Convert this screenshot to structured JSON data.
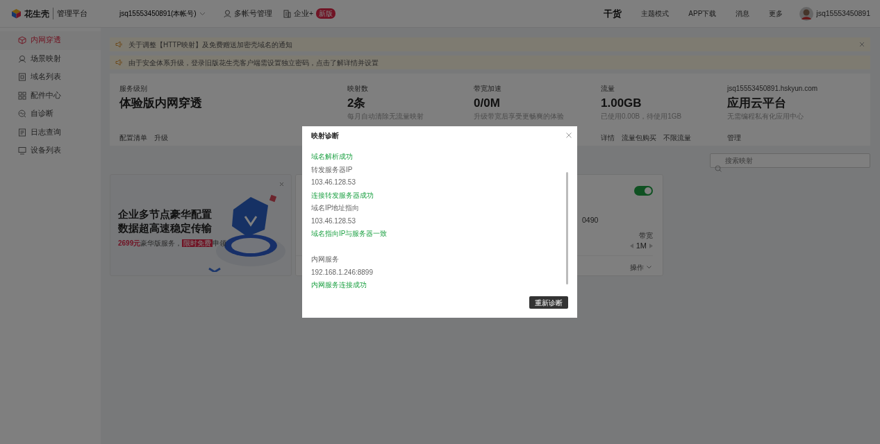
{
  "header": {
    "brand": "花生壳",
    "product": "管理平台",
    "account_select": "jsq15553450891(本帐号)",
    "links": [
      {
        "label": "多帐号管理",
        "kind": "user"
      },
      {
        "label": "企业+",
        "kind": "company",
        "badge": "新版"
      }
    ],
    "promo": "干货",
    "nav": [
      "主题模式",
      "APP下载",
      "消息",
      "更多"
    ],
    "user": "jsq15553450891"
  },
  "sidebar": {
    "items": [
      {
        "label": "内网穿透",
        "kind": "cube",
        "selected": true
      },
      {
        "label": "场景映射",
        "kind": "scene",
        "selected": false
      },
      {
        "label": "域名列表",
        "kind": "domain",
        "selected": false
      },
      {
        "label": "配件中心",
        "kind": "grid",
        "selected": false
      },
      {
        "label": "自诊断",
        "kind": "diag",
        "selected": false
      },
      {
        "label": "日志查询",
        "kind": "log",
        "selected": false
      },
      {
        "label": "设备列表",
        "kind": "device",
        "selected": false
      }
    ]
  },
  "notices": [
    {
      "text": "关于调整【HTTP映射】及免费赠送加密壳域名的通知",
      "closable": true
    },
    {
      "text": "由于安全体系升级，登录旧版花生壳客户端需设置独立密码，点击了解详情并设置",
      "closable": false
    }
  ],
  "stats": [
    {
      "label": "服务级别",
      "value": "体验版内网穿透",
      "links": [
        "配置清单",
        "升级"
      ]
    },
    {
      "label": "映射数",
      "value": "2条",
      "note": "每月自动清除无流量映射"
    },
    {
      "label": "带宽加速",
      "value": "0/0M",
      "note": "升级带宽后享受更畅爽的体验"
    },
    {
      "label": "流量",
      "value": "1.00GB",
      "note": "已使用0.00B，待使用1GB",
      "links": [
        "详情",
        "流量包购买",
        "不限流量"
      ]
    },
    {
      "label": "jsq15553450891.hskyun.com",
      "value": "应用云平台",
      "note": "无需编程私有化应用中心",
      "links": [
        "管理"
      ]
    }
  ],
  "search": {
    "placeholder": "搜索映射"
  },
  "ad": {
    "headline": [
      "企业多节点豪华配置",
      "数据超高速稳定传输"
    ],
    "price": "2699元",
    "text": "豪华版服务，",
    "tag": "限时免费",
    "suffix": "申领"
  },
  "mapping_card": {
    "on": true,
    "partial_text": "0490",
    "bandwidth_label": "带宽",
    "bandwidth": "1M",
    "actions": "操作"
  },
  "dialog": {
    "title": "映射诊断",
    "sections": [
      [
        {
          "text": "域名解析成功",
          "kind": "success"
        },
        {
          "text": "转发服务器IP",
          "kind": "label"
        },
        {
          "text": "103.46.128.53",
          "kind": "value"
        },
        {
          "text": "连接转发服务器成功",
          "kind": "success"
        },
        {
          "text": "域名IP地址指向",
          "kind": "label"
        },
        {
          "text": "103.46.128.53",
          "kind": "value"
        },
        {
          "text": "域名指向IP与服务器一致",
          "kind": "success"
        }
      ],
      [
        {
          "text": "内网服务",
          "kind": "label"
        },
        {
          "text": "192.168.1.246:8899",
          "kind": "value"
        },
        {
          "text": "内网服务连接成功",
          "kind": "success"
        }
      ]
    ],
    "button": "重新诊断"
  }
}
